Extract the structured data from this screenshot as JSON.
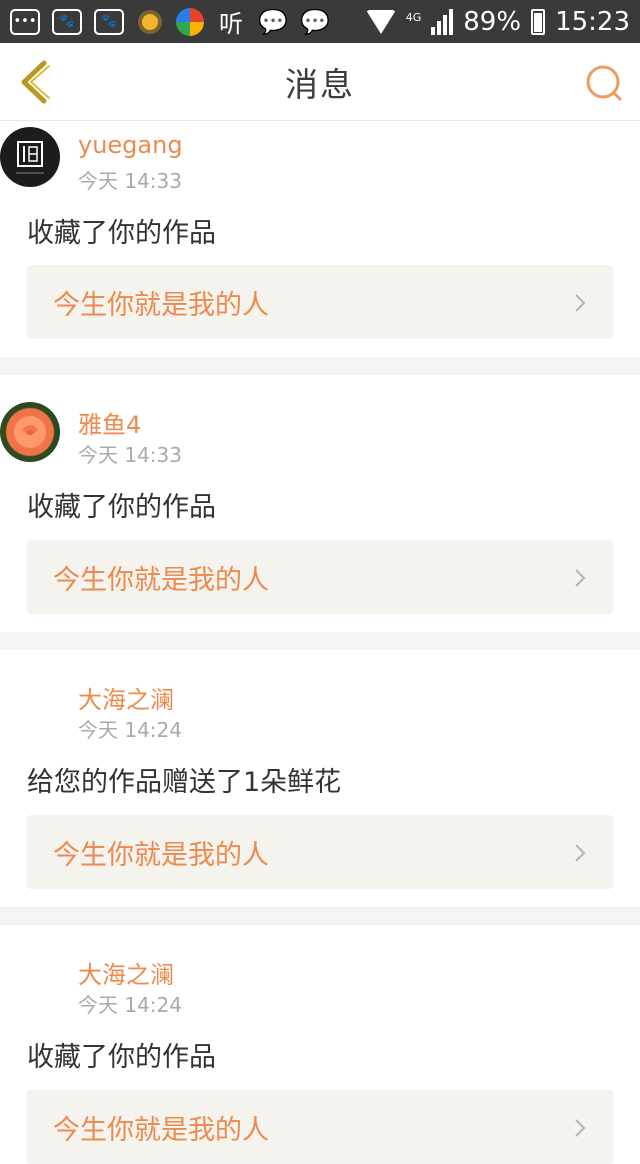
{
  "status_bar": {
    "network": "4G",
    "battery": "89%",
    "time": "15:23",
    "listen_icon": "听"
  },
  "nav": {
    "title": "消息",
    "back_icon": "chevron-left-icon",
    "search_icon": "search-icon"
  },
  "colors": {
    "accent": "#ee8a4d",
    "link_bg": "#f4f3ed",
    "separator": "#f4f4f4"
  },
  "messages": [
    {
      "username": "yuegang",
      "time": "今天 14:33",
      "text": "收藏了你的作品",
      "work": "今生你就是我的人",
      "avatar": "logo-avatar"
    },
    {
      "username": "雅鱼4",
      "time": "今天 14:33",
      "text": "收藏了你的作品",
      "work": "今生你就是我的人",
      "avatar": "rose-avatar"
    },
    {
      "username": "大海之澜",
      "time": "今天 14:24",
      "text": "给您的作品赠送了1朵鲜花",
      "work": "今生你就是我的人",
      "avatar": "blank-avatar"
    },
    {
      "username": "大海之澜",
      "time": "今天 14:24",
      "text": "收藏了你的作品",
      "work": "今生你就是我的人",
      "avatar": "blank-avatar"
    }
  ]
}
